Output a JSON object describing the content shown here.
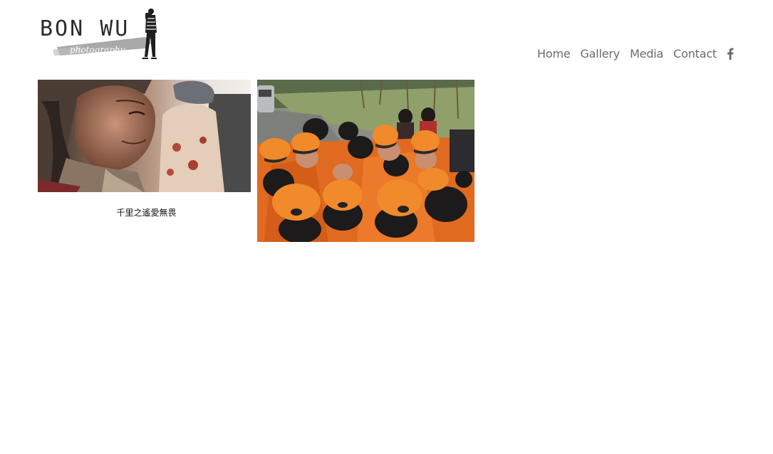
{
  "brand": {
    "name": "BON WU",
    "tagline": "photography"
  },
  "nav": {
    "items": [
      {
        "label": "Home"
      },
      {
        "label": "Gallery"
      },
      {
        "label": "Media"
      },
      {
        "label": "Contact"
      }
    ],
    "social_icon": "facebook-icon"
  },
  "gallery": {
    "items": [
      {
        "caption": "千里之遙愛無畏",
        "image": "elderly-woman-portrait"
      },
      {
        "caption": "",
        "image": "group-in-orange-caps"
      }
    ]
  },
  "colors": {
    "nav_text": "#6b6b6b",
    "cap_orange": "#f0882a",
    "logo_dark": "#2b2b2b"
  }
}
